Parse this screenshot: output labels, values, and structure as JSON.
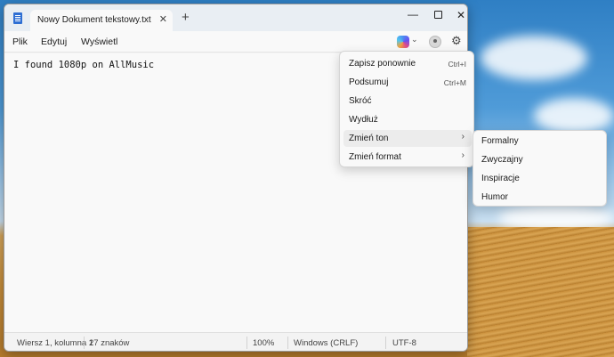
{
  "window": {
    "tab_title": "Nowy Dokument tekstowy.txt",
    "tab_close_icon": "close-icon",
    "new_tab_icon": "plus-icon",
    "controls": [
      "minimize-icon",
      "maximize-icon",
      "close-icon"
    ]
  },
  "menu": {
    "items": [
      "Plik",
      "Edytuj",
      "Wyświetl"
    ],
    "right_icons": [
      "copilot-icon",
      "chevron-down-icon",
      "account-icon",
      "gear-icon"
    ]
  },
  "editor": {
    "content": "I found 1080p on AllMusic"
  },
  "status": {
    "position": "Wiersz 1, kolumna 1",
    "chars": "27 znaków",
    "zoom": "100%",
    "line_endings": "Windows (CRLF)",
    "encoding": "UTF-8"
  },
  "context_menu": {
    "items": [
      {
        "label": "Zapisz ponownie",
        "shortcut": "Ctrl+I"
      },
      {
        "label": "Podsumuj",
        "shortcut": "Ctrl+M"
      },
      {
        "label": "Skróć",
        "shortcut": ""
      },
      {
        "label": "Wydłuż",
        "shortcut": ""
      },
      {
        "label": "Zmień ton",
        "shortcut": ""
      },
      {
        "label": "Zmień format",
        "shortcut": ""
      }
    ],
    "highlighted": "Zmień ton",
    "submenu_arrow_icon": "chevron-right-icon"
  },
  "submenu": {
    "items": [
      "Formalny",
      "Zwyczajny",
      "Inspiracje",
      "Humor"
    ]
  }
}
